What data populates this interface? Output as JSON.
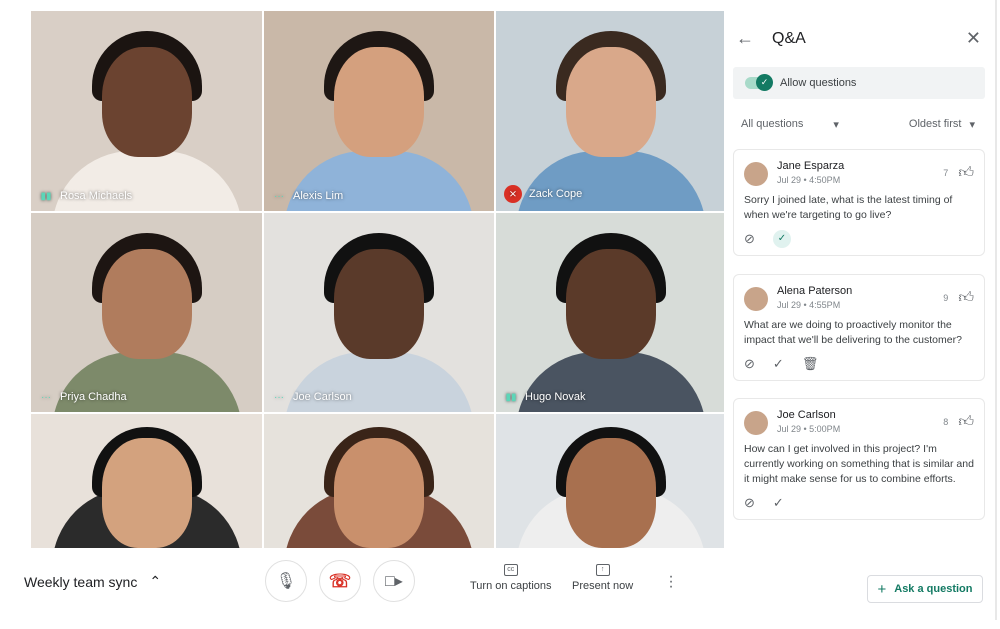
{
  "participants": [
    {
      "name": "Rosa Michaels",
      "status": "speaking",
      "bg": "#d9cfc6",
      "skin": "#6b4330",
      "shirt": "#f2ece6",
      "hair": "#1b1411"
    },
    {
      "name": "Alexis Lim",
      "status": "active",
      "bg": "#c9b8a8",
      "skin": "#d4a07e",
      "shirt": "#8fb3d9",
      "hair": "#1e1714"
    },
    {
      "name": "Zack Cope",
      "status": "muted",
      "bg": "#c7d1d7",
      "skin": "#d9a88a",
      "shirt": "#6f9cc4",
      "hair": "#3a2a20"
    },
    {
      "name": "Priya Chadha",
      "status": "active",
      "bg": "#d6cdc4",
      "skin": "#b07c5d",
      "shirt": "#7d8a6a",
      "hair": "#1d1512"
    },
    {
      "name": "Joe Carlson",
      "status": "active",
      "bg": "#e3e1de",
      "skin": "#5a3a2a",
      "shirt": "#c9d3dd",
      "hair": "#111"
    },
    {
      "name": "Hugo Novak",
      "status": "speaking",
      "bg": "#d7dcd8",
      "skin": "#5b3a29",
      "shirt": "#4a5461",
      "hair": "#111"
    },
    {
      "name": "",
      "status": "",
      "bg": "#e8e1da",
      "skin": "#d3a27e",
      "shirt": "#2b2b2b",
      "hair": "#111"
    },
    {
      "name": "",
      "status": "",
      "bg": "#e6e2dc",
      "skin": "#c9906c",
      "shirt": "#7a4b3a",
      "hair": "#3a2418"
    },
    {
      "name": "",
      "status": "",
      "bg": "#dfe3e6",
      "skin": "#a8704f",
      "shirt": "#eee",
      "hair": "#111"
    }
  ],
  "controls": {
    "meeting_title": "Weekly team sync",
    "captions_label": "Turn on captions",
    "present_label": "Present now",
    "hangup_color": "#d93025"
  },
  "qa": {
    "title": "Q&A",
    "allow_label": "Allow questions",
    "allow_enabled": true,
    "filter": "All questions",
    "sort": "Oldest first",
    "accent": "#137a63",
    "questions": [
      {
        "author": "Jane Esparza",
        "time": "Jul 29 • 4:50PM",
        "votes": "7",
        "text": "Sorry I joined late, what is the latest timing of when we're targeting to go live?",
        "answered": true
      },
      {
        "author": "Alena Paterson",
        "time": "Jul 29 • 4:55PM",
        "votes": "9",
        "text": "What are we doing to proactively monitor the impact that we'll be delivering to the customer?",
        "answered": false
      },
      {
        "author": "Joe Carlson",
        "time": "Jul 29 • 5:00PM",
        "votes": "8",
        "text": "How can I get involved in this project? I'm currently working on something that is similar and it might make sense for us to combine efforts.",
        "answered": false
      }
    ],
    "ask_label": "Ask a question"
  }
}
